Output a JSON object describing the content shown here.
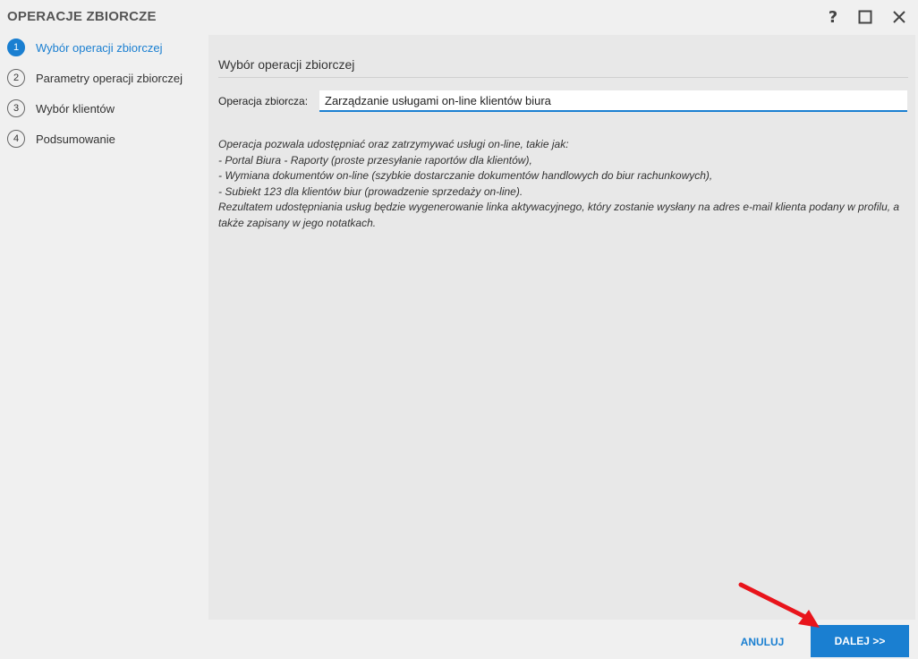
{
  "window": {
    "title": "OPERACJE ZBIORCZE",
    "help_glyph": "?"
  },
  "steps": [
    {
      "num": "1",
      "label": "Wybór operacji zbiorczej",
      "active": true
    },
    {
      "num": "2",
      "label": "Parametry operacji zbiorczej",
      "active": false
    },
    {
      "num": "3",
      "label": "Wybór klientów",
      "active": false
    },
    {
      "num": "4",
      "label": "Podsumowanie",
      "active": false
    }
  ],
  "main": {
    "section_title": "Wybór operacji zbiorczej",
    "field_label": "Operacja zbiorcza:",
    "field_value": "Zarządzanie usługami on-line klientów biura",
    "description": [
      "Operacja pozwala udostępniać oraz zatrzymywać usługi on-line, takie jak:",
      "- Portal Biura - Raporty (proste przesyłanie raportów dla klientów),",
      "- Wymiana dokumentów on-line (szybkie dostarczanie dokumentów handlowych do biur rachunkowych),",
      "- Subiekt 123 dla klientów biur (prowadzenie sprzedaży on-line).",
      "Rezultatem udostępniania usług będzie wygenerowanie linka aktywacyjnego, który zostanie wysłany na adres e-mail klienta podany w profilu, a także zapisany w jego notatkach."
    ]
  },
  "footer": {
    "cancel_label": "ANULUJ",
    "next_label": "DALEJ >>"
  },
  "colors": {
    "accent": "#1a7fd1",
    "annotation_arrow": "#e8141b"
  }
}
